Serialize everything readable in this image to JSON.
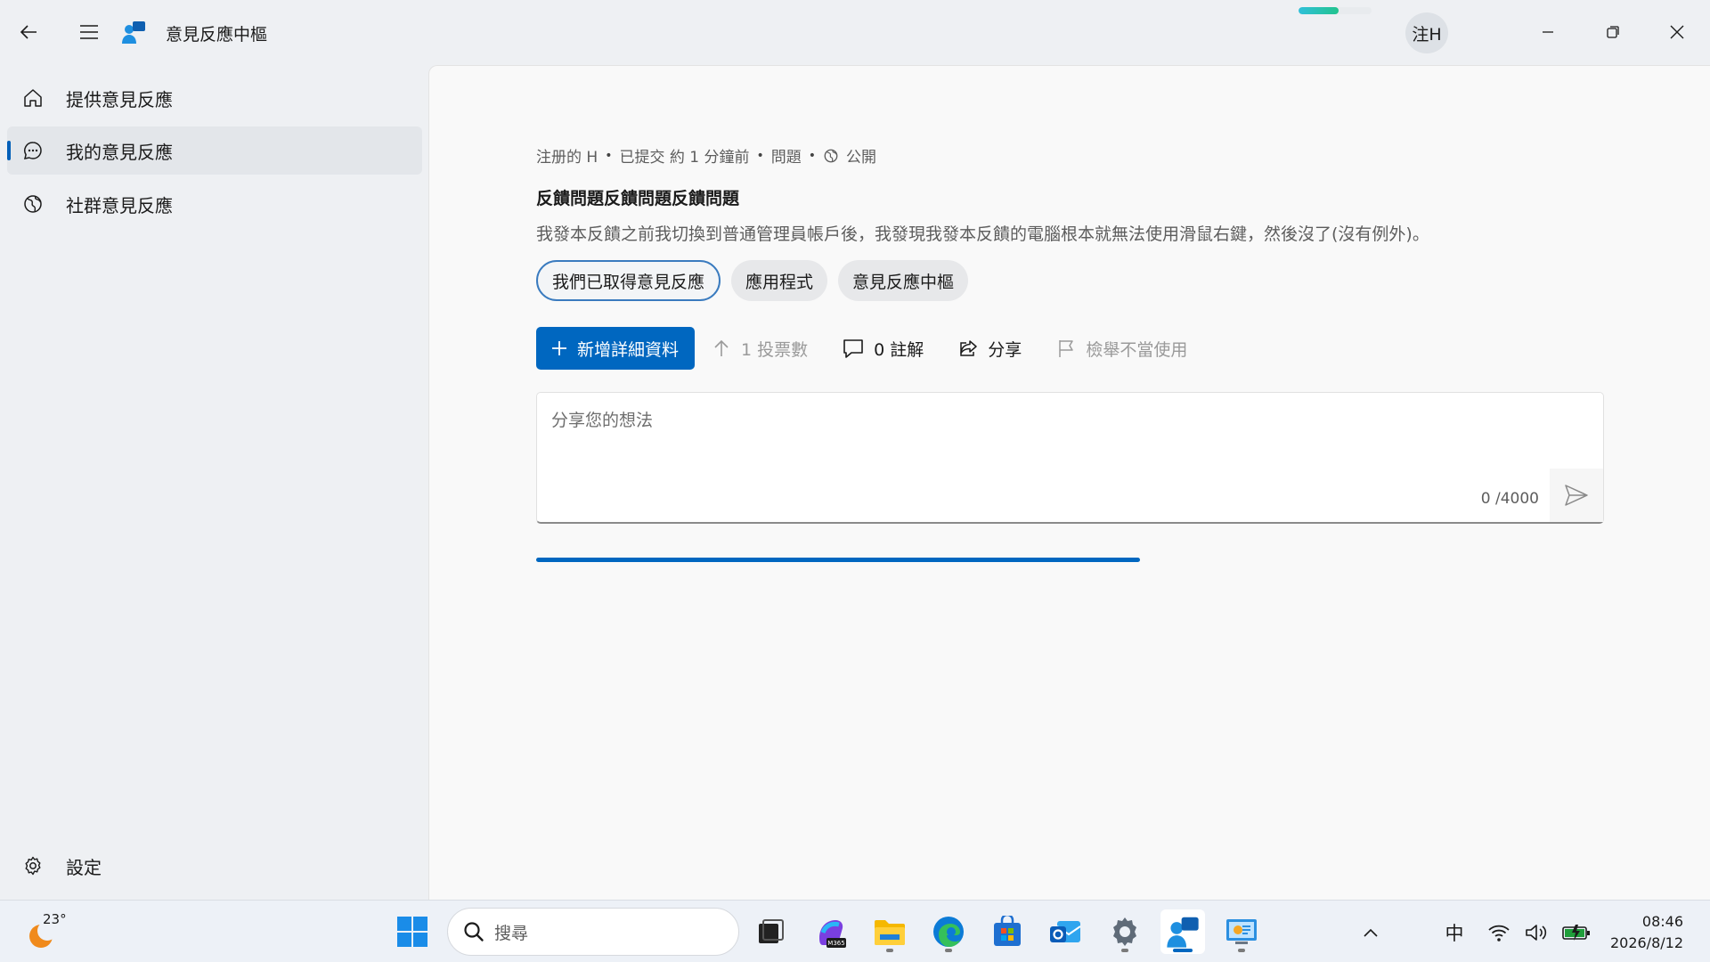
{
  "titlebar": {
    "app_title": "意見反應中樞",
    "avatar_initials": "注H",
    "sync_progress": 0.55
  },
  "sidebar": {
    "items": [
      {
        "label": "提供意見反應",
        "icon": "home-icon"
      },
      {
        "label": "我的意見反應",
        "icon": "chat-icon",
        "active": true
      },
      {
        "label": "社群意見反應",
        "icon": "globe-icon"
      }
    ],
    "settings_label": "設定"
  },
  "feedback": {
    "author": "注册的 H",
    "submitted": "已提交 約 1 分鐘前",
    "type": "問題",
    "visibility": "公開",
    "title": "反饋問題反饋問題反饋問題",
    "description": "我發本反饋之前我切換到普通管理員帳戶後，我發現我發本反饋的電腦根本就無法使用滑鼠右鍵，然後沒了(沒有例外)。",
    "tags": [
      "我們已取得意見反應",
      "應用程式",
      "意見反應中樞"
    ]
  },
  "actions": {
    "add_details": "新增詳細資料",
    "votes": "1 投票數",
    "comments": "0 註解",
    "share": "分享",
    "report": "檢舉不當使用"
  },
  "comment": {
    "placeholder": "分享您的想法",
    "counter": "0 /4000"
  },
  "taskbar": {
    "weather_temp": "23°",
    "search_placeholder": "搜尋",
    "ime": "中",
    "time": "08:46",
    "date": "2026/8/12",
    "accent": "#0067c0"
  }
}
